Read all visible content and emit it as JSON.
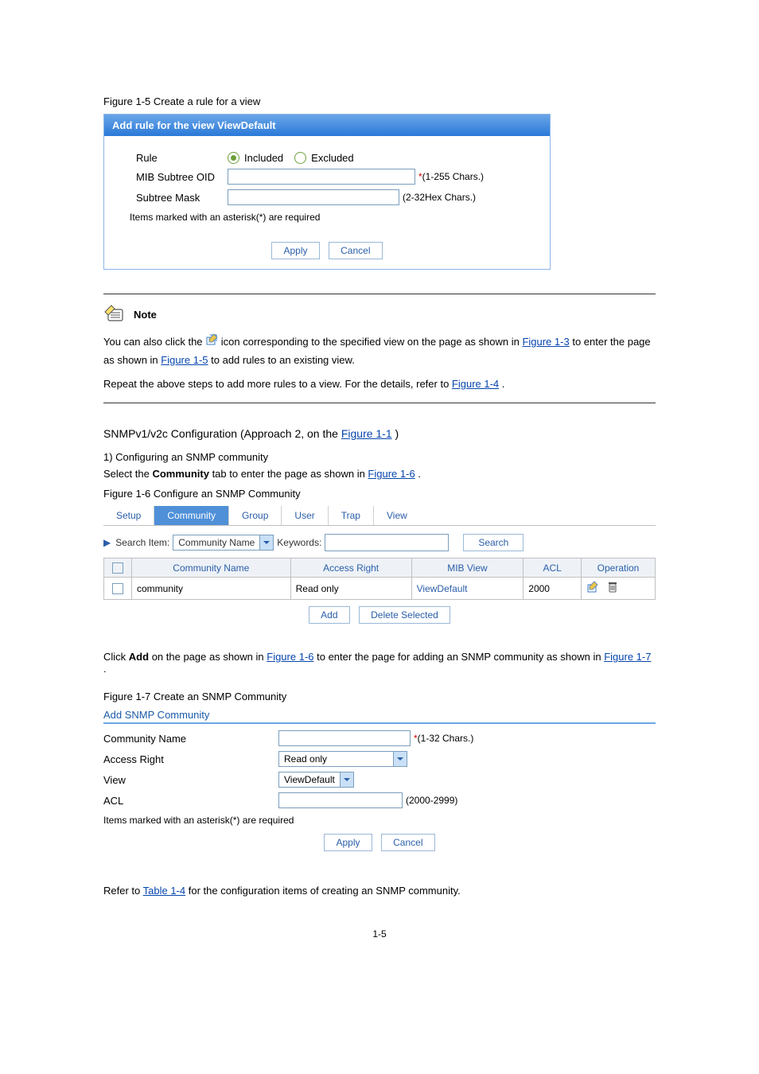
{
  "figure5": {
    "caption": "Figure 1-5 Create a rule for a view",
    "title": "Add rule for the view ViewDefault",
    "ruleLabel": "Rule",
    "included": "Included",
    "excluded": "Excluded",
    "mibLabel": "MIB Subtree OID",
    "mibHint": "*(1-255 Chars.)",
    "maskLabel": "Subtree Mask",
    "maskHint": "(2-32Hex Chars.)",
    "required": "Items marked with an asterisk(*) are required",
    "apply": "Apply",
    "cancel": "Cancel"
  },
  "note": {
    "heading": "Note",
    "lineA_pre": "You can also click the ",
    "lineA_post": " icon corresponding to the specified view on the page as shown in ",
    "lineA_link": "Figure 1-3",
    "lineA_tail": " to enter the page as shown in ",
    "lineA_link2": "Figure 1-5",
    "lineA_end": " to add rules to an existing view.",
    "lineB_pre": "Repeat the above steps to add more rules to a view. For the details, refer to ",
    "lineB_link": "Figure 1-4",
    "lineB_end": "."
  },
  "snmpv1v2": {
    "heading_pre": "SNMPv1/v2c Configuration (Approach 2, on the ",
    "heading_link": "Figure 1-1",
    "heading_mid": ")",
    "step1": "1) Configuring an SNMP community",
    "step1sub_pre": "Select the ",
    "step1sub_b": "Community",
    "step1sub_post": " tab to enter the page as shown in ",
    "step1sub_link": "Figure 1-6",
    "step1sub_end": "."
  },
  "figure6": {
    "caption": "Figure 1-6 Configure an SNMP Community",
    "tabs": [
      "Setup",
      "Community",
      "Group",
      "User",
      "Trap",
      "View"
    ],
    "activeTab": "Community",
    "searchLabel": "Search Item:",
    "searchSelect": "Community Name",
    "keywords": "Keywords:",
    "searchBtn": "Search",
    "columns": [
      "Community Name",
      "Access Right",
      "MIB View",
      "ACL",
      "Operation"
    ],
    "row": {
      "name": "community",
      "access": "Read only",
      "view": "ViewDefault",
      "acl": "2000"
    },
    "addBtn": "Add",
    "deleteBtn": "Delete Selected"
  },
  "step2": {
    "pre": "Click ",
    "b": "Add",
    "post": " on the page as shown in ",
    "link": "Figure 1-6",
    "mid": " to enter the page for adding an SNMP community as shown in ",
    "link2": "Figure 1-7",
    "end": "."
  },
  "figure7": {
    "caption": "Figure 1-7 Create an SNMP Community",
    "panelTitle": "Add SNMP Community",
    "nameLabel": "Community Name",
    "nameHint": "*(1-32 Chars.)",
    "accessLabel": "Access Right",
    "accessValue": "Read only",
    "viewLabel": "View",
    "viewValue": "ViewDefault",
    "aclLabel": "ACL",
    "aclHint": "(2000-2999)",
    "required": "Items marked with an asterisk(*) are required",
    "apply": "Apply",
    "cancel": "Cancel"
  },
  "tableRef": {
    "pre": "Refer to ",
    "link": "Table 1-4",
    "post": " for the configuration items of creating an SNMP community."
  },
  "pageNo": "1-5"
}
